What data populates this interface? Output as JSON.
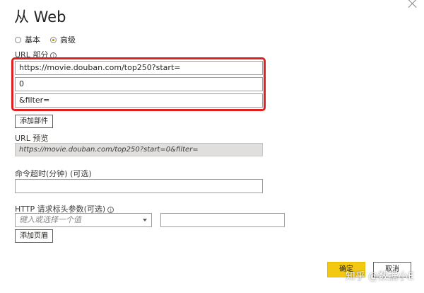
{
  "dialog": {
    "title": "从 Web",
    "mode_basic": "基本",
    "mode_advanced": "高级",
    "selected_mode": "高级"
  },
  "url_parts": {
    "label": "URL 部分",
    "info_icon": "info-icon",
    "parts": [
      "https://movie.douban.com/top250?start=",
      "0",
      "&filter="
    ],
    "add_part_button": "添加部件"
  },
  "url_preview": {
    "label": "URL 预览",
    "value": "https://movie.douban.com/top250?start=0&filter="
  },
  "timeout": {
    "label": "命令超时(分钟) (可选)",
    "value": ""
  },
  "http_headers": {
    "label": "HTTP 请求标头参数(可选)",
    "info_icon": "info-icon",
    "header_placeholder": "键入或选择一个值",
    "header_value": "",
    "add_header_button": "添加页眉"
  },
  "footer": {
    "ok_button": "确定",
    "cancel_button": "取消"
  },
  "watermark": "知乎 @数据小E",
  "colors": {
    "highlight_border": "#e02020",
    "ok_button_bg": "#f2c811",
    "radio_selected": "#b88a00"
  }
}
